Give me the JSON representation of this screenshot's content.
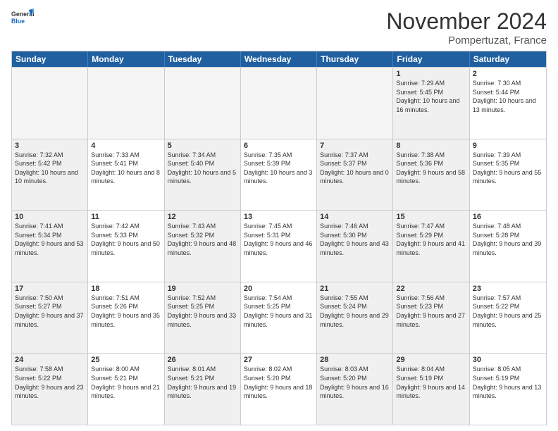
{
  "logo": {
    "line1": "General",
    "line2": "Blue"
  },
  "title": "November 2024",
  "location": "Pompertuzat, France",
  "headers": [
    "Sunday",
    "Monday",
    "Tuesday",
    "Wednesday",
    "Thursday",
    "Friday",
    "Saturday"
  ],
  "rows": [
    [
      {
        "day": "",
        "info": "",
        "empty": true
      },
      {
        "day": "",
        "info": "",
        "empty": true
      },
      {
        "day": "",
        "info": "",
        "empty": true
      },
      {
        "day": "",
        "info": "",
        "empty": true
      },
      {
        "day": "",
        "info": "",
        "empty": true
      },
      {
        "day": "1",
        "info": "Sunrise: 7:29 AM\nSunset: 5:45 PM\nDaylight: 10 hours and 16 minutes.",
        "shaded": true
      },
      {
        "day": "2",
        "info": "Sunrise: 7:30 AM\nSunset: 5:44 PM\nDaylight: 10 hours and 13 minutes."
      }
    ],
    [
      {
        "day": "3",
        "info": "Sunrise: 7:32 AM\nSunset: 5:42 PM\nDaylight: 10 hours and 10 minutes.",
        "shaded": true
      },
      {
        "day": "4",
        "info": "Sunrise: 7:33 AM\nSunset: 5:41 PM\nDaylight: 10 hours and 8 minutes."
      },
      {
        "day": "5",
        "info": "Sunrise: 7:34 AM\nSunset: 5:40 PM\nDaylight: 10 hours and 5 minutes.",
        "shaded": true
      },
      {
        "day": "6",
        "info": "Sunrise: 7:35 AM\nSunset: 5:39 PM\nDaylight: 10 hours and 3 minutes."
      },
      {
        "day": "7",
        "info": "Sunrise: 7:37 AM\nSunset: 5:37 PM\nDaylight: 10 hours and 0 minutes.",
        "shaded": true
      },
      {
        "day": "8",
        "info": "Sunrise: 7:38 AM\nSunset: 5:36 PM\nDaylight: 9 hours and 58 minutes.",
        "shaded": true
      },
      {
        "day": "9",
        "info": "Sunrise: 7:39 AM\nSunset: 5:35 PM\nDaylight: 9 hours and 55 minutes."
      }
    ],
    [
      {
        "day": "10",
        "info": "Sunrise: 7:41 AM\nSunset: 5:34 PM\nDaylight: 9 hours and 53 minutes.",
        "shaded": true
      },
      {
        "day": "11",
        "info": "Sunrise: 7:42 AM\nSunset: 5:33 PM\nDaylight: 9 hours and 50 minutes."
      },
      {
        "day": "12",
        "info": "Sunrise: 7:43 AM\nSunset: 5:32 PM\nDaylight: 9 hours and 48 minutes.",
        "shaded": true
      },
      {
        "day": "13",
        "info": "Sunrise: 7:45 AM\nSunset: 5:31 PM\nDaylight: 9 hours and 46 minutes."
      },
      {
        "day": "14",
        "info": "Sunrise: 7:46 AM\nSunset: 5:30 PM\nDaylight: 9 hours and 43 minutes.",
        "shaded": true
      },
      {
        "day": "15",
        "info": "Sunrise: 7:47 AM\nSunset: 5:29 PM\nDaylight: 9 hours and 41 minutes.",
        "shaded": true
      },
      {
        "day": "16",
        "info": "Sunrise: 7:48 AM\nSunset: 5:28 PM\nDaylight: 9 hours and 39 minutes."
      }
    ],
    [
      {
        "day": "17",
        "info": "Sunrise: 7:50 AM\nSunset: 5:27 PM\nDaylight: 9 hours and 37 minutes.",
        "shaded": true
      },
      {
        "day": "18",
        "info": "Sunrise: 7:51 AM\nSunset: 5:26 PM\nDaylight: 9 hours and 35 minutes."
      },
      {
        "day": "19",
        "info": "Sunrise: 7:52 AM\nSunset: 5:25 PM\nDaylight: 9 hours and 33 minutes.",
        "shaded": true
      },
      {
        "day": "20",
        "info": "Sunrise: 7:54 AM\nSunset: 5:25 PM\nDaylight: 9 hours and 31 minutes."
      },
      {
        "day": "21",
        "info": "Sunrise: 7:55 AM\nSunset: 5:24 PM\nDaylight: 9 hours and 29 minutes.",
        "shaded": true
      },
      {
        "day": "22",
        "info": "Sunrise: 7:56 AM\nSunset: 5:23 PM\nDaylight: 9 hours and 27 minutes.",
        "shaded": true
      },
      {
        "day": "23",
        "info": "Sunrise: 7:57 AM\nSunset: 5:22 PM\nDaylight: 9 hours and 25 minutes."
      }
    ],
    [
      {
        "day": "24",
        "info": "Sunrise: 7:58 AM\nSunset: 5:22 PM\nDaylight: 9 hours and 23 minutes.",
        "shaded": true
      },
      {
        "day": "25",
        "info": "Sunrise: 8:00 AM\nSunset: 5:21 PM\nDaylight: 9 hours and 21 minutes."
      },
      {
        "day": "26",
        "info": "Sunrise: 8:01 AM\nSunset: 5:21 PM\nDaylight: 9 hours and 19 minutes.",
        "shaded": true
      },
      {
        "day": "27",
        "info": "Sunrise: 8:02 AM\nSunset: 5:20 PM\nDaylight: 9 hours and 18 minutes."
      },
      {
        "day": "28",
        "info": "Sunrise: 8:03 AM\nSunset: 5:20 PM\nDaylight: 9 hours and 16 minutes.",
        "shaded": true
      },
      {
        "day": "29",
        "info": "Sunrise: 8:04 AM\nSunset: 5:19 PM\nDaylight: 9 hours and 14 minutes.",
        "shaded": true
      },
      {
        "day": "30",
        "info": "Sunrise: 8:05 AM\nSunset: 5:19 PM\nDaylight: 9 hours and 13 minutes."
      }
    ]
  ]
}
